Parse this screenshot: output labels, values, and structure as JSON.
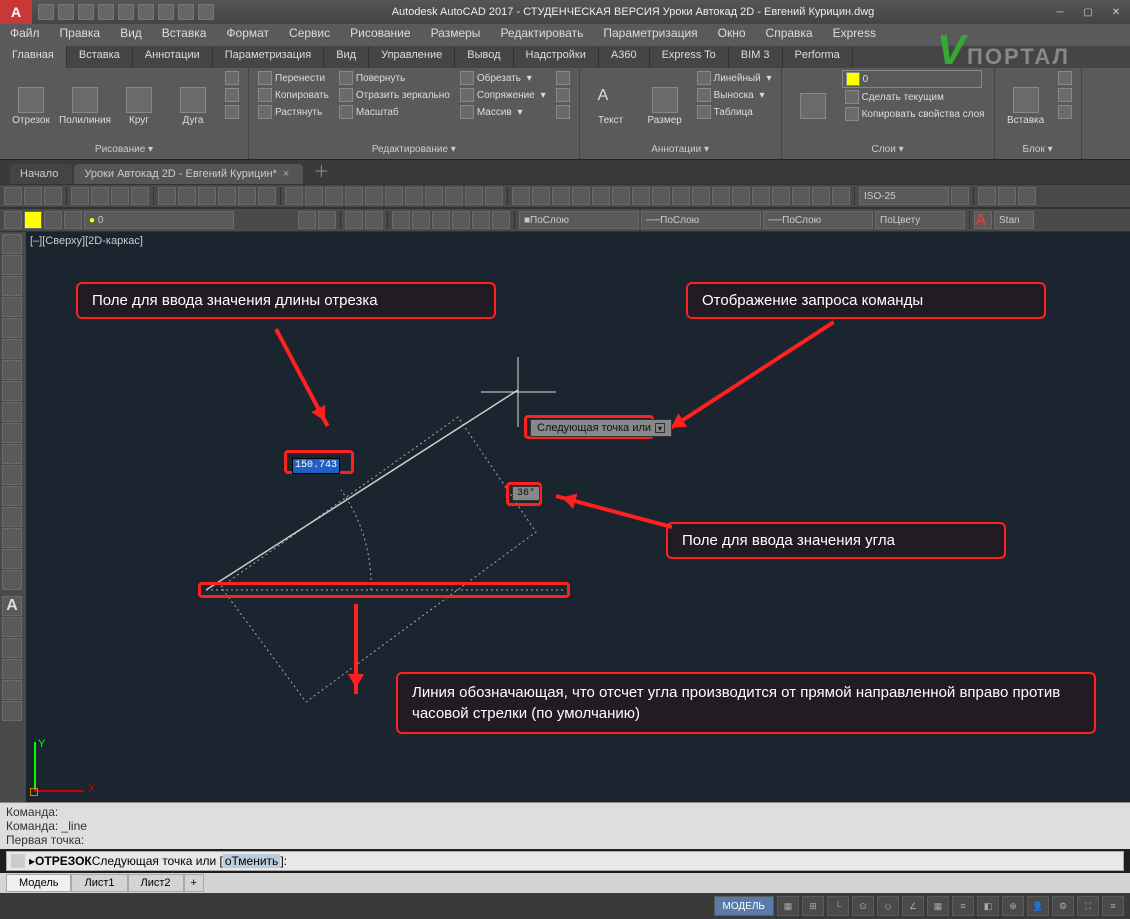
{
  "title": "Autodesk AutoCAD 2017 - СТУДЕНЧЕСКАЯ ВЕРСИЯ   Уроки Автокад 2D - Евгений Курицин.dwg",
  "menus": [
    "Файл",
    "Правка",
    "Вид",
    "Вставка",
    "Формат",
    "Сервис",
    "Рисование",
    "Размеры",
    "Редактировать",
    "Параметризация",
    "Окно",
    "Справка",
    "Express"
  ],
  "tabs": [
    "Главная",
    "Вставка",
    "Аннотации",
    "Параметризация",
    "Вид",
    "Управление",
    "Вывод",
    "Надстройки",
    "A360",
    "Express To",
    "BIM 3",
    "Performa"
  ],
  "ribbon": {
    "draw": {
      "title": "Рисование ▾",
      "items": [
        "Отрезок",
        "Полилиния",
        "Круг",
        "Дуга"
      ]
    },
    "modify": {
      "title": "Редактирование ▾",
      "move": "Перенести",
      "copy": "Копировать",
      "stretch": "Растянуть",
      "rotate": "Повернуть",
      "mirror": "Отразить зеркально",
      "scale": "Масштаб",
      "trim": "Обрезать",
      "fillet": "Сопряжение",
      "array": "Массив"
    },
    "annot": {
      "title": "Аннотации ▾",
      "text": "Текст",
      "dim": "Размер",
      "l1": "Линейный",
      "l2": "Выноска",
      "l3": "Таблица"
    },
    "layers": {
      "title": "Слои ▾",
      "l1": "Сделать текущим",
      "l2": "Копировать свойства слоя"
    },
    "block": {
      "title": "Блок ▾",
      "ins": "Вставка"
    }
  },
  "doctabs": {
    "start": "Начало",
    "doc": "Уроки Автокад 2D - Евгений Курицин*"
  },
  "combos": {
    "dimstyle": "ISO-25",
    "bylayer1": "ПоСлою",
    "bylayer2": "ПоСлою",
    "bylayer3": "ПоСлою",
    "bycolor": "ПоЦвету",
    "layer0": "0"
  },
  "viewlabel": "[–][Сверху][2D-каркас]",
  "callouts": {
    "len": "Поле для ввода значения длины отрезка",
    "cmd": "Отображение запроса команды",
    "ang": "Поле для ввода значения угла",
    "baseline": "Линия обозначающая, что отсчет угла производится от прямой направленной вправо против часовой стрелки (по умолчанию)"
  },
  "dyninput": {
    "len": "150.743",
    "prompt": "Следующая точка или",
    "angle": "36°"
  },
  "cmdhistory": [
    "Команда:",
    "Команда: _line",
    "Первая точка:"
  ],
  "cmdline": {
    "cmd": "ОТРЕЗОК",
    "rest": " Следующая точка или [",
    "opt": "оТменить",
    "tail": "]:"
  },
  "bottomtabs": [
    "Модель",
    "Лист1",
    "Лист2"
  ],
  "status": {
    "model": "МОДЕЛЬ"
  },
  "watermark": "ПОРТАЛ"
}
